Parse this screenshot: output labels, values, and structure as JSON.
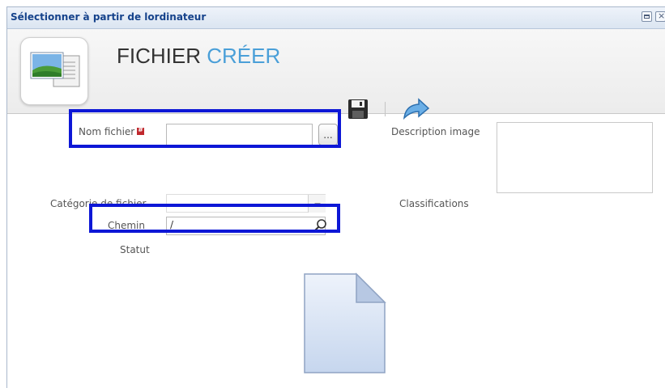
{
  "window": {
    "title": "Sélectionner à partir de lordinateur",
    "close_glyph": "×"
  },
  "header": {
    "title_word1": "FICHIER",
    "title_word2": "CRÉER",
    "title_word2_color": "#4a9fd8"
  },
  "icons": {
    "header": "image-file-icon",
    "save": "floppy-disk-icon",
    "reset": "undo-arrow-icon",
    "browse": "ellipsis-icon",
    "search": "magnifier-icon",
    "dropdown": "chevron-down-icon",
    "required": "required-marker-icon",
    "preview": "blank-document-icon"
  },
  "form": {
    "nom_fichier_label": "Nom fichier",
    "nom_fichier_value": "",
    "browse_label": "...",
    "description_label": "Description image",
    "description_value": "",
    "categorie_label": "Catégorie de fichier",
    "categorie_value": "",
    "classifications_label": "Classifications",
    "chemin_label": "Chemin",
    "chemin_value": "/",
    "statut_label": "Statut"
  },
  "colors": {
    "highlight": "#0d17d6",
    "required_marker": "#c0282d"
  }
}
